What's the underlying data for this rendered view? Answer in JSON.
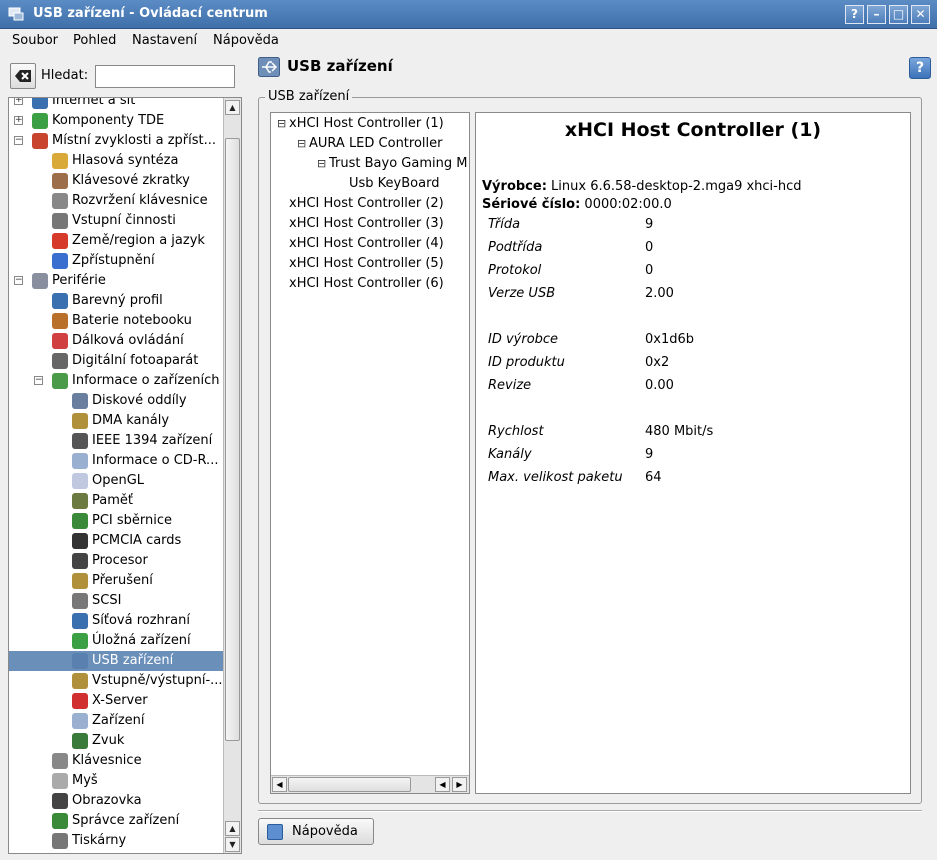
{
  "window": {
    "title": "USB zařízení - Ovládací centrum",
    "buttons": [
      "?",
      "–",
      "□",
      "✕"
    ]
  },
  "menu": [
    "Soubor",
    "Pohled",
    "Nastavení",
    "Nápověda"
  ],
  "search": {
    "label": "Hledat:",
    "value": ""
  },
  "nav": {
    "rows": [
      {
        "label": "Internet a síť",
        "level": 0,
        "expander": "+",
        "icon": "globe-icon",
        "color": "#3a6fb0"
      },
      {
        "label": "Komponenty TDE",
        "level": 0,
        "expander": "+",
        "icon": "components-icon",
        "color": "#3aa043"
      },
      {
        "label": "Místní zvyklosti a zpříst...",
        "level": 0,
        "expander": "−",
        "icon": "locale-icon",
        "color": "#c8442c"
      },
      {
        "label": "Hlasová syntéza",
        "level": 1,
        "icon": "speech-icon",
        "color": "#d9a93a"
      },
      {
        "label": "Klávesové zkratky",
        "level": 1,
        "icon": "shortcuts-icon",
        "color": "#9c6f4a"
      },
      {
        "label": "Rozvržení klávesnice",
        "level": 1,
        "icon": "keyboard-icon",
        "color": "#888888"
      },
      {
        "label": "Vstupní činnosti",
        "level": 1,
        "icon": "input-actions-icon",
        "color": "#777777"
      },
      {
        "label": "Země/region a jazyk",
        "level": 1,
        "icon": "flag-icon",
        "color": "#d63a2a"
      },
      {
        "label": "Zpřístupnění",
        "level": 1,
        "icon": "accessibility-icon",
        "color": "#3a6fd0"
      },
      {
        "label": "Periférie",
        "level": 0,
        "expander": "−",
        "icon": "peripherals-icon",
        "color": "#8a8fa0"
      },
      {
        "label": "Barevný profil",
        "level": 1,
        "icon": "color-profile-icon",
        "color": "#3a6fb0"
      },
      {
        "label": "Baterie notebooku",
        "level": 1,
        "icon": "battery-icon",
        "color": "#b8702a"
      },
      {
        "label": "Dálková ovládání",
        "level": 1,
        "icon": "remote-icon",
        "color": "#d04040"
      },
      {
        "label": "Digitální fotoaparát",
        "level": 1,
        "icon": "camera-icon",
        "color": "#666666"
      },
      {
        "label": "Informace o zařízeních",
        "level": 1,
        "expander": "−",
        "icon": "device-info-icon",
        "color": "#4a9a4a"
      },
      {
        "label": "Diskové oddíly",
        "level": 2,
        "icon": "partitions-icon",
        "color": "#6a7fa0"
      },
      {
        "label": "DMA kanály",
        "level": 2,
        "icon": "dma-icon",
        "color": "#b0903a"
      },
      {
        "label": "IEEE 1394 zařízení",
        "level": 2,
        "icon": "firewire-icon",
        "color": "#555555"
      },
      {
        "label": "Informace o CD-R...",
        "level": 2,
        "icon": "cdrom-icon",
        "color": "#9ab0d0"
      },
      {
        "label": "OpenGL",
        "level": 2,
        "icon": "opengl-icon",
        "color": "#c0c8e0"
      },
      {
        "label": "Paměť",
        "level": 2,
        "icon": "memory-icon",
        "color": "#6a7a40"
      },
      {
        "label": "PCI sběrnice",
        "level": 2,
        "icon": "pci-icon",
        "color": "#3a8a3a"
      },
      {
        "label": "PCMCIA cards",
        "level": 2,
        "icon": "pcmcia-icon",
        "color": "#333333"
      },
      {
        "label": "Procesor",
        "level": 2,
        "icon": "cpu-icon",
        "color": "#444444"
      },
      {
        "label": "Přerušení",
        "level": 2,
        "icon": "interrupts-icon",
        "color": "#b0903a"
      },
      {
        "label": "SCSI",
        "level": 2,
        "icon": "scsi-icon",
        "color": "#777777"
      },
      {
        "label": "Síťová rozhraní",
        "level": 2,
        "icon": "network-icon",
        "color": "#3a6fb0"
      },
      {
        "label": "Úložná zařízení",
        "level": 2,
        "icon": "storage-icon",
        "color": "#3aa043"
      },
      {
        "label": "USB zařízení",
        "level": 2,
        "icon": "usb-icon",
        "color": "#5a80b0",
        "selected": true
      },
      {
        "label": "Vstupně/výstupní-...",
        "level": 2,
        "icon": "io-ports-icon",
        "color": "#b0903a"
      },
      {
        "label": "X-Server",
        "level": 2,
        "icon": "xserver-icon",
        "color": "#d03030"
      },
      {
        "label": "Zařízení",
        "level": 2,
        "icon": "devices-icon",
        "color": "#9ab0d0"
      },
      {
        "label": "Zvuk",
        "level": 2,
        "icon": "sound-icon",
        "color": "#3a7a3a"
      },
      {
        "label": "Klávesnice",
        "level": 1,
        "icon": "keyboard-icon",
        "color": "#888888"
      },
      {
        "label": "Myš",
        "level": 1,
        "icon": "mouse-icon",
        "color": "#aaaaaa"
      },
      {
        "label": "Obrazovka",
        "level": 1,
        "icon": "display-icon",
        "color": "#444444"
      },
      {
        "label": "Správce zařízení",
        "level": 1,
        "icon": "device-manager-icon",
        "color": "#3a8a3a"
      },
      {
        "label": "Tiskárny",
        "level": 1,
        "icon": "printer-icon",
        "color": "#777777"
      }
    ]
  },
  "module": {
    "title": "USB zařízení",
    "help": "?"
  },
  "group": {
    "title": "USB zařízení"
  },
  "device_tree": [
    {
      "label": "xHCI Host Controller (1)",
      "level": 0,
      "expander": "⊟"
    },
    {
      "label": "AURA LED Controller",
      "level": 1,
      "expander": "⊟"
    },
    {
      "label": "Trust Bayo Gaming M",
      "level": 2,
      "expander": "⊟"
    },
    {
      "label": "Usb KeyBoard",
      "level": 3,
      "expander": ""
    },
    {
      "label": "xHCI Host Controller (2)",
      "level": 0,
      "expander": ""
    },
    {
      "label": "xHCI Host Controller (3)",
      "level": 0,
      "expander": ""
    },
    {
      "label": "xHCI Host Controller (4)",
      "level": 0,
      "expander": ""
    },
    {
      "label": "xHCI Host Controller (5)",
      "level": 0,
      "expander": ""
    },
    {
      "label": "xHCI Host Controller (6)",
      "level": 0,
      "expander": ""
    }
  ],
  "detail": {
    "heading": "xHCI Host Controller (1)",
    "manufacturer_label": "Výrobce:",
    "manufacturer": "Linux 6.6.58-desktop-2.mga9 xhci-hcd",
    "serial_label": "Sériové číslo:",
    "serial": "0000:02:00.0",
    "props": [
      {
        "k": "Třída",
        "v": "9"
      },
      {
        "k": "Podtřída",
        "v": "0"
      },
      {
        "k": "Protokol",
        "v": "0"
      },
      {
        "k": "Verze USB",
        "v": "2.00"
      },
      {
        "k": "",
        "v": ""
      },
      {
        "k": "ID výrobce",
        "v": "0x1d6b"
      },
      {
        "k": "ID produktu",
        "v": "0x2"
      },
      {
        "k": "Revize",
        "v": "0.00"
      },
      {
        "k": "",
        "v": ""
      },
      {
        "k": "Rychlost",
        "v": "480 Mbit/s"
      },
      {
        "k": "Kanály",
        "v": "9"
      },
      {
        "k": "Max. velikost paketu",
        "v": "64"
      }
    ]
  },
  "footer": {
    "help_button": "Nápověda"
  }
}
